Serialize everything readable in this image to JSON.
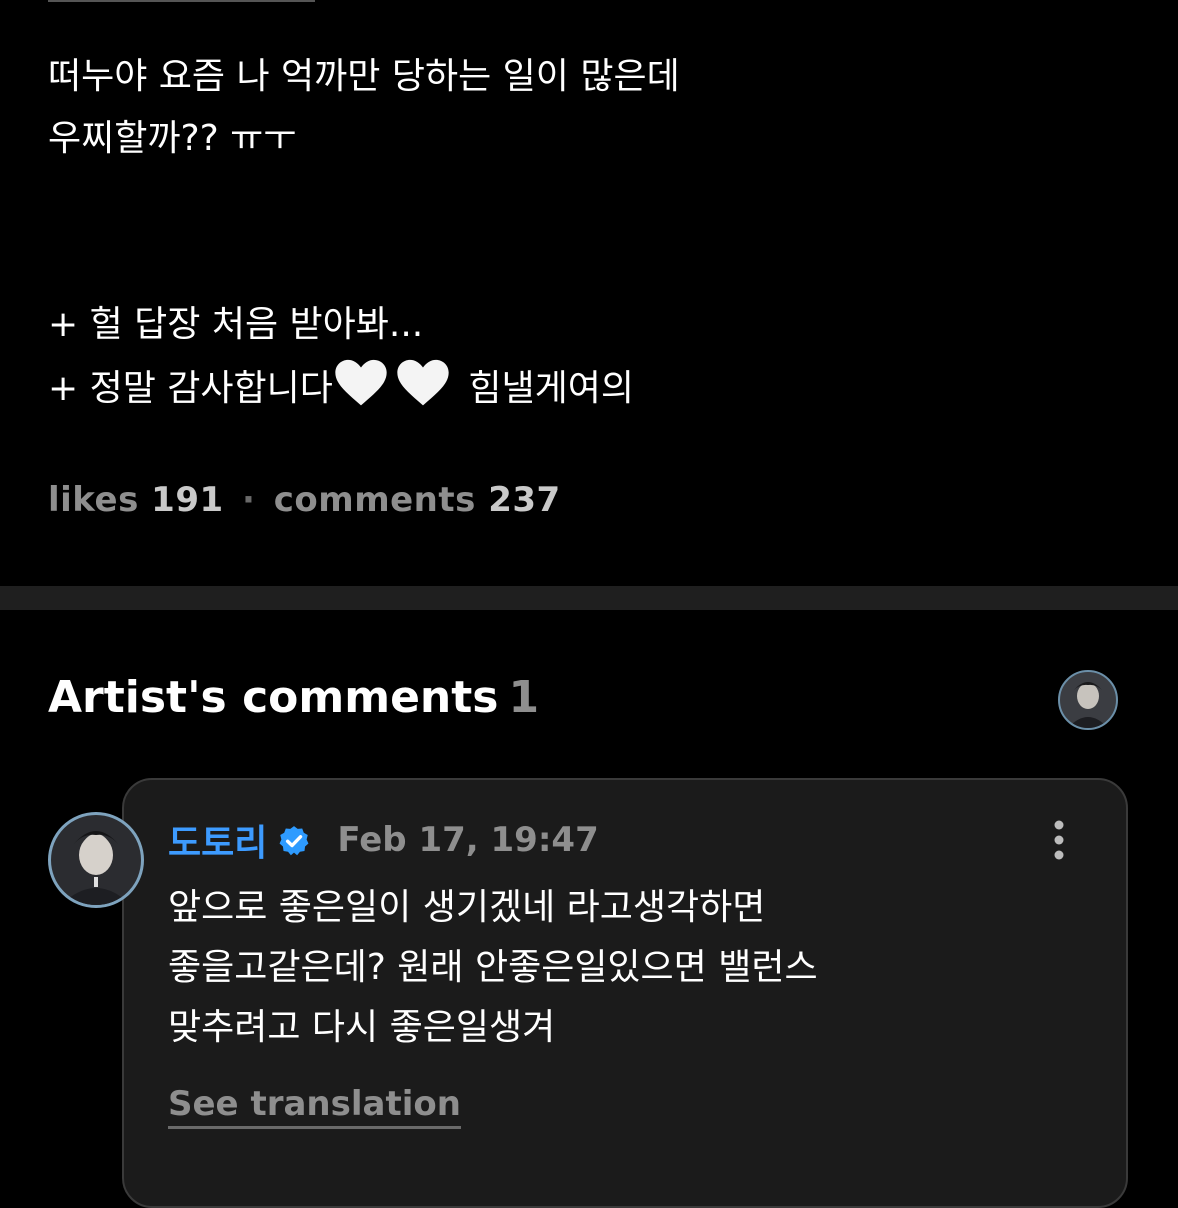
{
  "post": {
    "lines": [
      "떠누야 요즘 나 억까만 당하는 일이 많은데",
      "우찌할까?? ㅠㅜ",
      "",
      "",
      "+ 헐 답장 처음 받아봐...",
      "+ 정말 감사합니다",
      "힘낼게여의"
    ],
    "heart_icon": "white-heart-icon"
  },
  "stats": {
    "likes_label": "likes",
    "likes_count": "191",
    "separator": "·",
    "comments_label": "comments",
    "comments_count": "237"
  },
  "artist_comments": {
    "title": "Artist's comments",
    "count": "1"
  },
  "comment": {
    "author": "도토리",
    "verified_icon": "verified-badge-icon",
    "timestamp": "Feb 17, 19:47",
    "lines": [
      "앞으로 좋은일이 생기겠네 라고생각하면",
      "좋을고같은데? 원래 안좋은일있으면 밸런스",
      "맞추려고 다시 좋은일생겨"
    ],
    "see_translation": "See translation"
  },
  "colors": {
    "background": "#000000",
    "card": "#1b1b1b",
    "author_blue": "#3d9bff",
    "muted": "#8e8e8e",
    "divider": "#1f1f1f"
  }
}
